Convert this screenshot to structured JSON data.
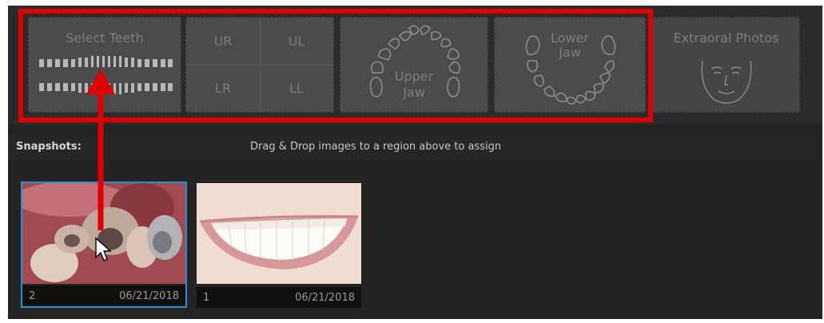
{
  "colors": {
    "highlight": "#e00000",
    "tile_bg": "#4b4b4b",
    "selected_border": "#2c8fd1"
  },
  "toolbar": {
    "select_teeth_label": "Select Teeth",
    "quadrants": {
      "ur": "UR",
      "ul": "UL",
      "lr": "LR",
      "ll": "LL"
    },
    "upper_jaw_label": [
      "Upper",
      "Jaw"
    ],
    "lower_jaw_label": [
      "Lower",
      "Jaw"
    ],
    "extraoral_label": "Extraoral Photos"
  },
  "snapshots": {
    "label": "Snapshots:",
    "hint": "Drag & Drop images to a region above to assign",
    "items": [
      {
        "index": "2",
        "date": "06/21/2018",
        "image": "intraoral-teeth-photo",
        "selected": true
      },
      {
        "index": "1",
        "date": "06/21/2018",
        "image": "smile-photo",
        "selected": false
      }
    ]
  },
  "annotation": {
    "icons": [
      "red-arrow-icon",
      "mouse-cursor-icon"
    ]
  }
}
